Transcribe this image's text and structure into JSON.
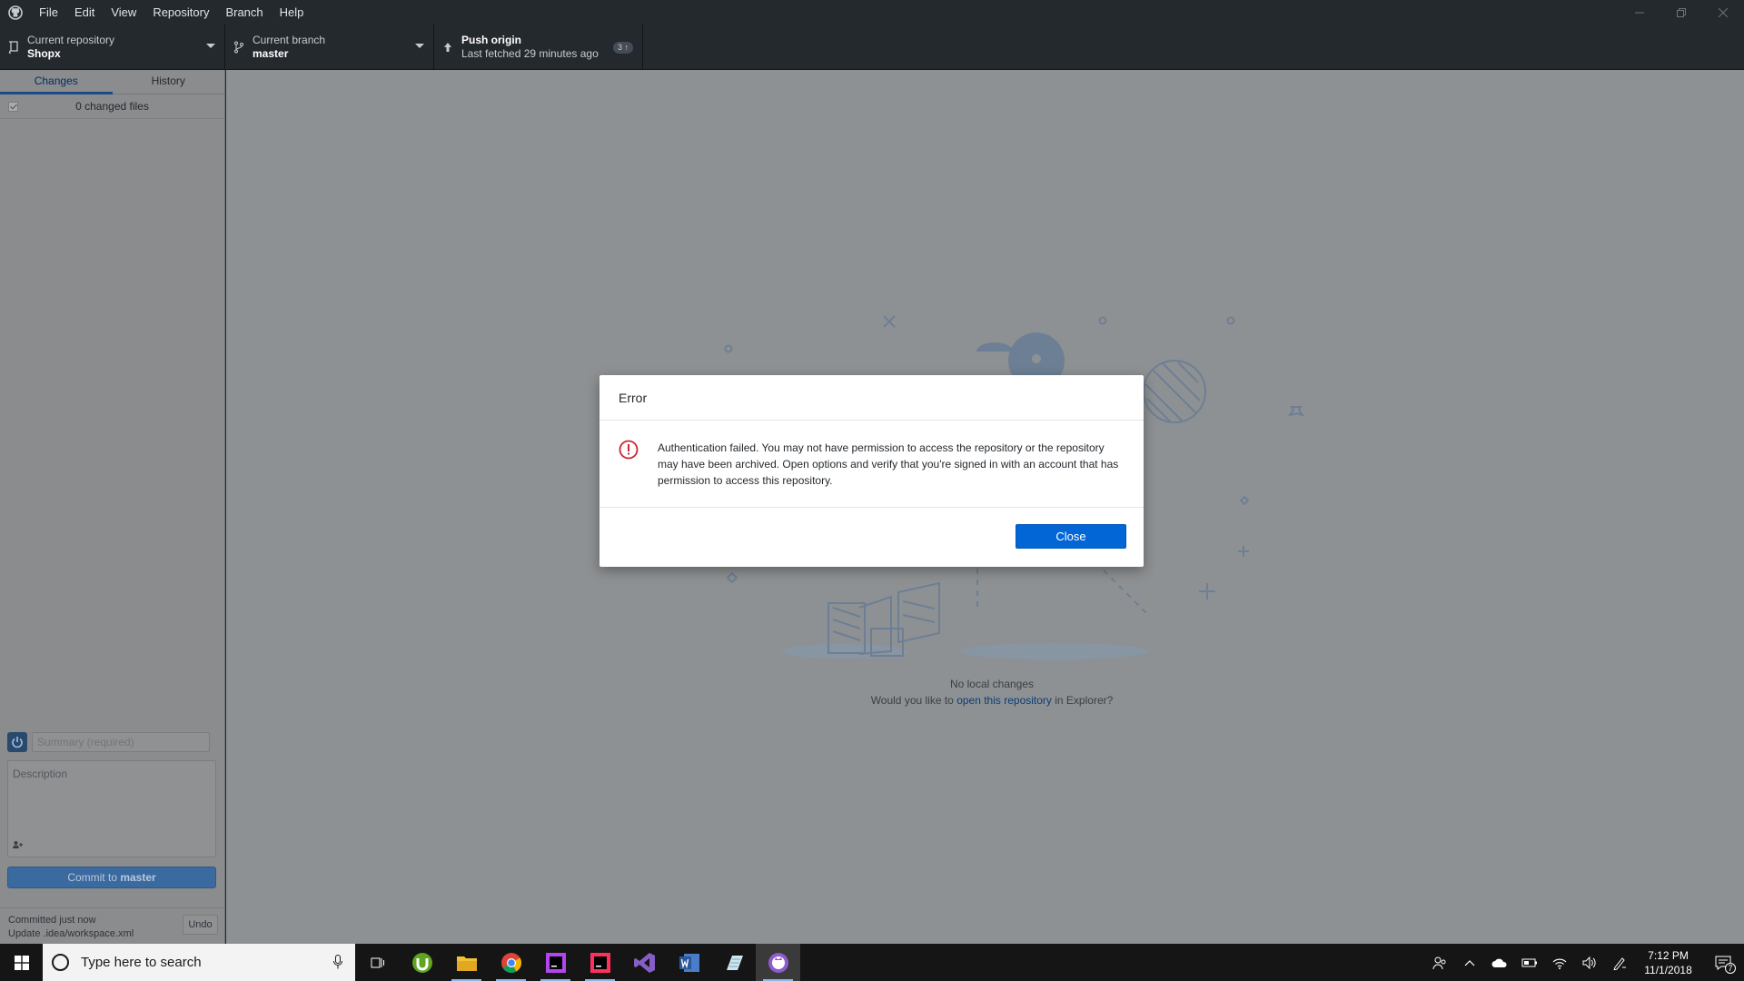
{
  "menu": [
    "File",
    "Edit",
    "View",
    "Repository",
    "Branch",
    "Help"
  ],
  "toolbar": {
    "repo_label": "Current repository",
    "repo_value": "Shopx",
    "branch_label": "Current branch",
    "branch_value": "master",
    "push_label": "Push origin",
    "push_sub": "Last fetched 29 minutes ago",
    "push_badge": "3 ↑"
  },
  "sidebar": {
    "tabs": [
      "Changes",
      "History"
    ],
    "active_tab": "Changes",
    "changed_files": "0 changed files",
    "summary_placeholder": "Summary (required)",
    "description_placeholder": "Description",
    "commit_prefix": "Commit to ",
    "commit_branch": "master",
    "last_commit_time": "Committed just now",
    "last_commit_msg": "Update .idea/workspace.xml",
    "undo": "Undo"
  },
  "main": {
    "empty_title": "No local changes",
    "empty_prefix": "Would you like to ",
    "empty_link": "open this repository",
    "empty_suffix": " in Explorer?"
  },
  "dialog": {
    "title": "Error",
    "message": "Authentication failed. You may not have permission to access the repository or the repository may have been archived. Open options and verify that you're signed in with an account that has permission to access this repository.",
    "close": "Close"
  },
  "taskbar": {
    "search_placeholder": "Type here to search",
    "time": "7:12 PM",
    "date": "11/1/2018",
    "notification_count": "7"
  },
  "colors": {
    "accent": "#0366d6",
    "error": "#cb2431",
    "titlebar": "#24292e"
  }
}
